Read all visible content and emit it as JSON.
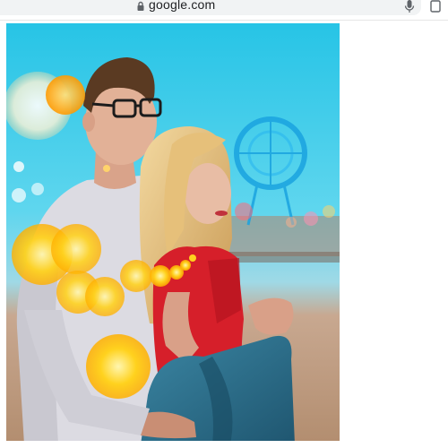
{
  "browser": {
    "url": "google.com",
    "lock_icon": "lock-icon",
    "mic_icon": "microphone-icon",
    "tabs_icon": "tab-switcher-icon"
  },
  "image": {
    "subject": "couple-photo",
    "colors": {
      "sky": "#3fc9e8",
      "sand": "#c9a78a",
      "bokeh": "#ffc41c",
      "dress": "#d8202c",
      "jacket": "#2c6f8a",
      "sweater": "#d9d8de"
    }
  }
}
